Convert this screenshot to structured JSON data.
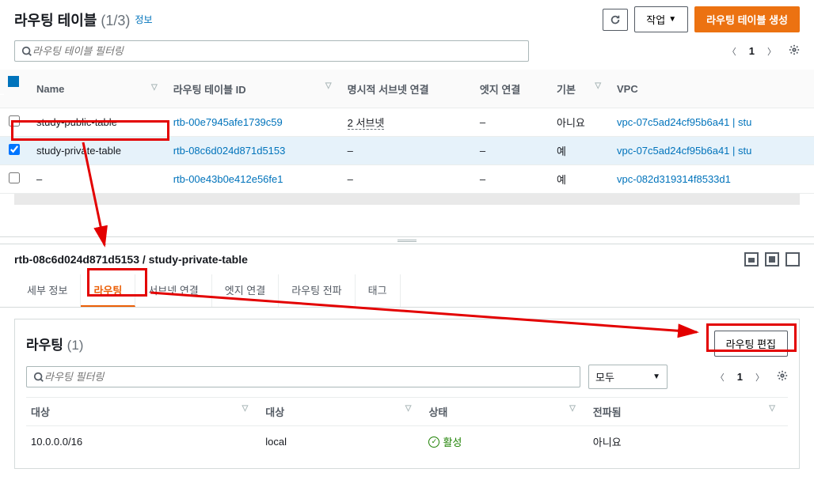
{
  "header": {
    "title": "라우팅 테이블",
    "count": "(1/3)",
    "info": "정보",
    "refresh_label": "새로고침",
    "actions_label": "작업",
    "create_label": "라우팅 테이블 생성"
  },
  "filter": {
    "placeholder": "라우팅 테이블 필터링",
    "page": "1"
  },
  "columns": {
    "name": "Name",
    "rtid": "라우팅 테이블 ID",
    "explicit": "명시적 서브넷 연결",
    "edge": "엣지 연결",
    "main": "기본",
    "vpc": "VPC"
  },
  "rows": [
    {
      "selected": false,
      "name": "study-public-table",
      "rtid": "rtb-00e7945afe1739c59",
      "explicit": "2 서브넷",
      "edge": "–",
      "main": "아니요",
      "vpc": "vpc-07c5ad24cf95b6a41 | stu"
    },
    {
      "selected": true,
      "name": "study-private-table",
      "rtid": "rtb-08c6d024d871d5153",
      "explicit": "–",
      "edge": "–",
      "main": "예",
      "vpc": "vpc-07c5ad24cf95b6a41 | stu"
    },
    {
      "selected": false,
      "name": "–",
      "rtid": "rtb-00e43b0e412e56fe1",
      "explicit": "–",
      "edge": "–",
      "main": "예",
      "vpc": "vpc-082d319314f8533d1"
    }
  ],
  "detail": {
    "title": "rtb-08c6d024d871d5153 / study-private-table"
  },
  "tabs": {
    "details": "세부 정보",
    "routes": "라우팅",
    "subnet": "서브넷 연결",
    "edge": "엣지 연결",
    "propagation": "라우팅 전파",
    "tags": "태그"
  },
  "routes_panel": {
    "title": "라우팅",
    "count": "(1)",
    "edit": "라우팅 편집",
    "filter_placeholder": "라우팅 필터링",
    "select_all": "모두",
    "page": "1"
  },
  "route_columns": {
    "destination": "대상",
    "target": "대상",
    "status": "상태",
    "propagated": "전파됨"
  },
  "route_rows": [
    {
      "destination": "10.0.0.0/16",
      "target": "local",
      "status": "활성",
      "propagated": "아니요"
    }
  ]
}
